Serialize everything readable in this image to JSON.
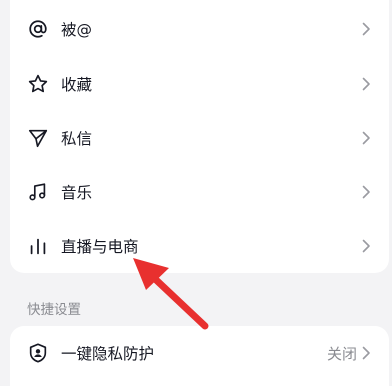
{
  "menu": {
    "items": [
      {
        "label": "被@",
        "icon": "at-icon"
      },
      {
        "label": "收藏",
        "icon": "star-icon"
      },
      {
        "label": "私信",
        "icon": "send-icon"
      },
      {
        "label": "音乐",
        "icon": "music-note-icon"
      },
      {
        "label": "直播与电商",
        "icon": "bar-chart-icon"
      }
    ]
  },
  "quick_settings": {
    "title": "快捷设置",
    "items": [
      {
        "label": "一键隐私防护",
        "value": "关闭",
        "icon": "shield-user-icon"
      }
    ]
  },
  "annotation": {
    "arrow_color": "#e8302f"
  },
  "colors": {
    "text_primary": "#161823",
    "text_secondary": "#8a8b91",
    "background": "#f3f3f5",
    "card": "#ffffff"
  }
}
